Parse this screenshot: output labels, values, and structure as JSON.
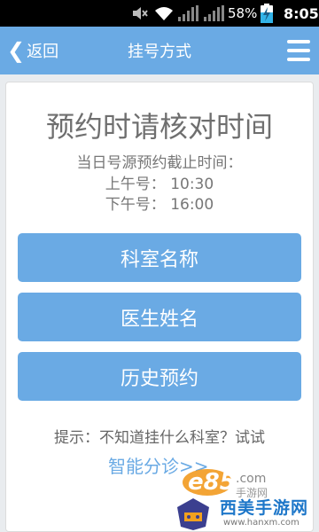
{
  "status_bar": {
    "battery": "58%",
    "time": "8:05",
    "icons": [
      "mute-icon",
      "wifi-icon",
      "signal-icon",
      "signal-icon",
      "battery-charging-icon"
    ]
  },
  "header": {
    "back_label": "返回",
    "title": "挂号方式"
  },
  "main": {
    "title": "预约时请核对时间",
    "cutoff_label": "当日号源预约截止时间：",
    "morning": "上午号：  10:30",
    "afternoon": "下午号：  16:00",
    "buttons": [
      {
        "label": "科室名称"
      },
      {
        "label": "医生姓名"
      },
      {
        "label": "历史预约"
      }
    ],
    "hint": "提示：不知道挂什么科室？试试",
    "smart_link": "智能分诊>>"
  },
  "watermark": {
    "logo": "e85.com",
    "sub": "手游网",
    "brand": "西美手游网",
    "url": "www.hanxm.com"
  },
  "colors": {
    "accent": "#6aaae4",
    "status_bar": "#000000",
    "background": "#e9ecef"
  }
}
